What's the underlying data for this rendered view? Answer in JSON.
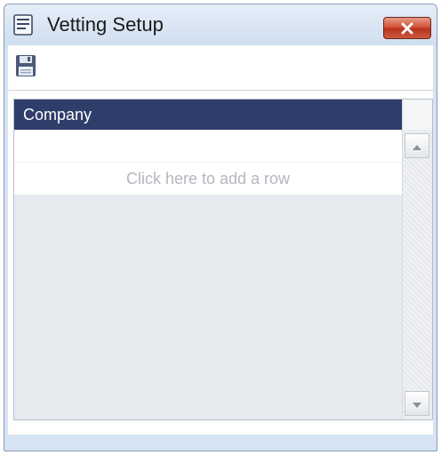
{
  "window": {
    "title": "Vetting Setup",
    "title_icon": "document-list-icon",
    "close_icon": "close-icon"
  },
  "toolbar": {
    "save_icon": "save-icon"
  },
  "grid": {
    "columns": [
      "Company"
    ],
    "rows": [],
    "add_row_text": "Click here to add a row"
  },
  "colors": {
    "header_bg": "#2f3d6b",
    "close_button": "#c9442b",
    "window_frame": "#d6e3f2"
  }
}
